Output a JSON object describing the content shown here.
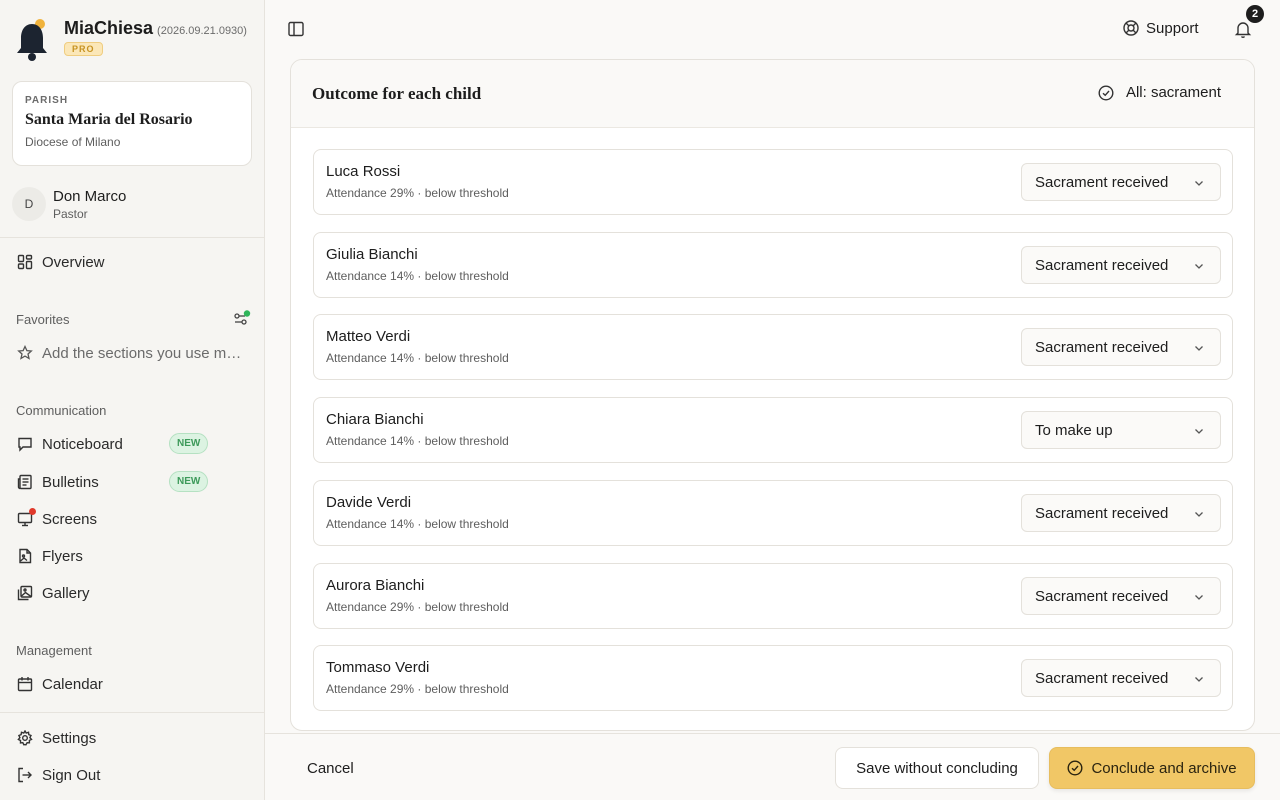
{
  "brand": {
    "name": "MiaChiesa",
    "version": "(2026.09.21.0930)",
    "badge": "PRO"
  },
  "parish": {
    "label": "PARISH",
    "name": "Santa Maria del Rosario",
    "diocese": "Diocese of Milano"
  },
  "user": {
    "initial": "D",
    "name": "Don Marco",
    "role": "Pastor"
  },
  "nav": {
    "overview": "Overview",
    "favorites_title": "Favorites",
    "favorites_hint": "Add the sections you use most",
    "communication_title": "Communication",
    "communication": [
      {
        "label": "Noticeboard",
        "badge": "NEW"
      },
      {
        "label": "Bulletins",
        "badge": "NEW"
      },
      {
        "label": "Screens"
      },
      {
        "label": "Flyers"
      },
      {
        "label": "Gallery"
      }
    ],
    "management_title": "Management",
    "calendar": "Calendar",
    "settings": "Settings",
    "signout": "Sign Out"
  },
  "topbar": {
    "support": "Support",
    "notifications": "2"
  },
  "panel": {
    "title": "Outcome for each child",
    "all_button": "All: sacrament",
    "children": [
      {
        "name": "Luca Rossi",
        "attendance": "Attendance 29% · below threshold",
        "outcome": "Sacrament received"
      },
      {
        "name": "Giulia Bianchi",
        "attendance": "Attendance 14% · below threshold",
        "outcome": "Sacrament received"
      },
      {
        "name": "Matteo Verdi",
        "attendance": "Attendance 14% · below threshold",
        "outcome": "Sacrament received"
      },
      {
        "name": "Chiara Bianchi",
        "attendance": "Attendance 14% · below threshold",
        "outcome": "To make up"
      },
      {
        "name": "Davide Verdi",
        "attendance": "Attendance 14% · below threshold",
        "outcome": "Sacrament received"
      },
      {
        "name": "Aurora Bianchi",
        "attendance": "Attendance 29% · below threshold",
        "outcome": "Sacrament received"
      },
      {
        "name": "Tommaso Verdi",
        "attendance": "Attendance 29% · below threshold",
        "outcome": "Sacrament received"
      }
    ]
  },
  "footer": {
    "cancel": "Cancel",
    "save": "Save without concluding",
    "conclude": "Conclude and archive"
  },
  "colors": {
    "accent": "#f1c766",
    "new_badge": "#dcf3e2",
    "alert_dot": "#e0392b",
    "online_dot": "#2fb55a"
  }
}
